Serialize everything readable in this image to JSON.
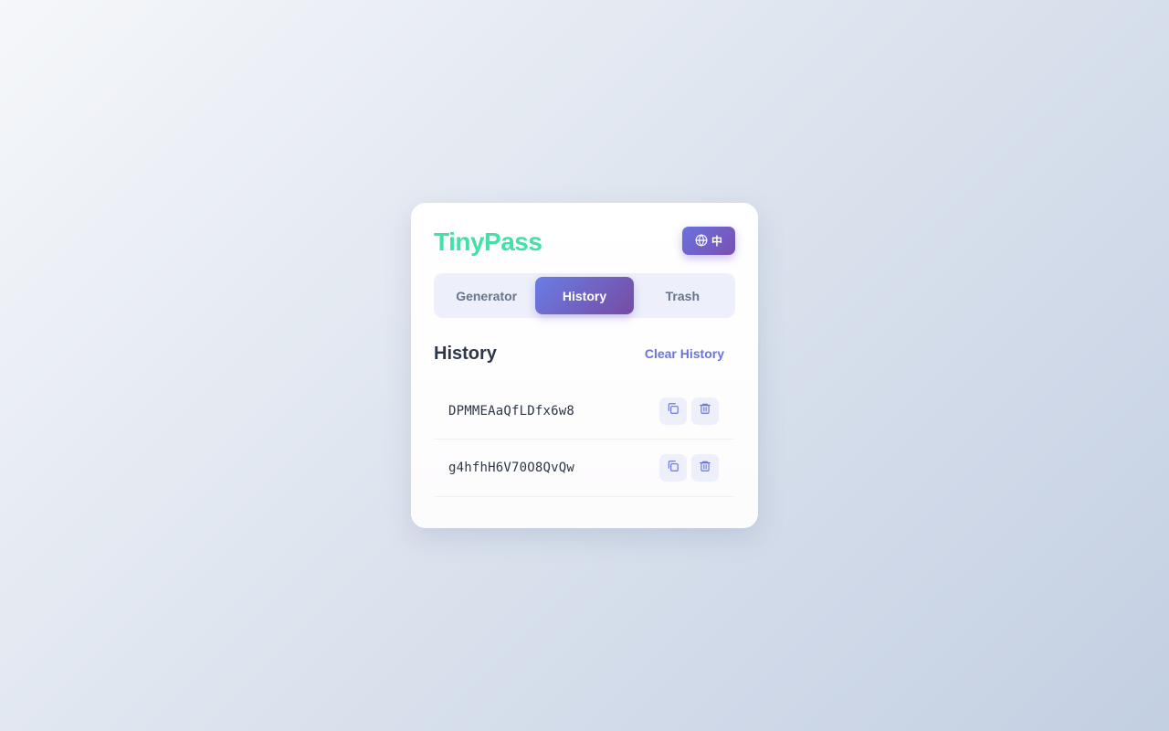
{
  "app": {
    "logo": "TinyPass",
    "lang_label": "中",
    "accent_color": "#6a75d6",
    "logo_color": "#42e1a5"
  },
  "tabs": [
    {
      "label": "Generator",
      "active": false
    },
    {
      "label": "History",
      "active": true
    },
    {
      "label": "Trash",
      "active": false
    }
  ],
  "history": {
    "title": "History",
    "clear_label": "Clear History",
    "items": [
      {
        "password": "DPMMEAaQfLDfx6w8",
        "copy_icon": "copy-icon",
        "delete_icon": "trash-icon"
      },
      {
        "password": "g4hfhH6V70O8QvQw",
        "copy_icon": "copy-icon",
        "delete_icon": "trash-icon"
      }
    ]
  }
}
